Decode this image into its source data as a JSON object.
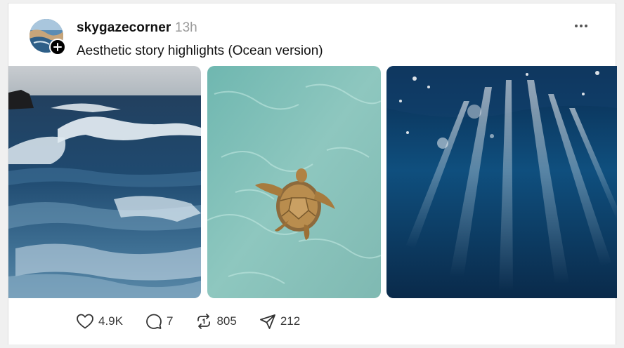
{
  "post": {
    "username": "skygazecorner",
    "timestamp": "13h",
    "caption": "Aesthetic story highlights (Ocean version)",
    "more_icon": "more-horizontal-icon",
    "images": [
      {
        "subject": "crashing ocean waves"
      },
      {
        "subject": "sea turtle in clear water"
      },
      {
        "subject": "underwater sun rays"
      }
    ],
    "stats": {
      "likes": "4.9K",
      "replies": "7",
      "reposts": "805",
      "shares": "212"
    },
    "icons": {
      "like": "heart-icon",
      "reply": "comment-bubble-icon",
      "repost": "repost-icon",
      "share": "send-icon"
    }
  },
  "colors": {
    "text_primary": "#111111",
    "text_secondary": "#9a9a9a",
    "background": "#ffffff"
  }
}
